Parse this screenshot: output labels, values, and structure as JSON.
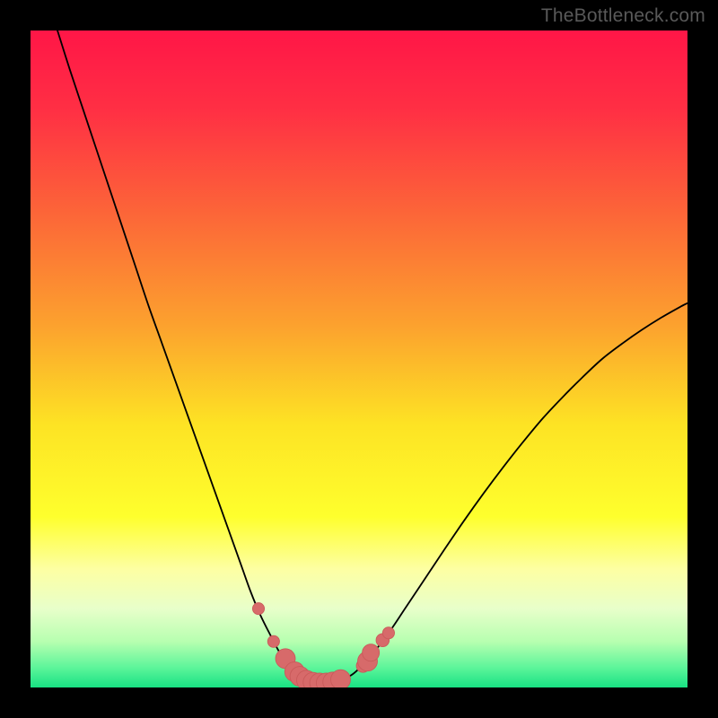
{
  "watermark": "TheBottleneck.com",
  "colors": {
    "marker_fill": "#d76a6a",
    "marker_stroke": "#c95a5a",
    "curve_stroke": "#000000"
  },
  "gradient_stops": [
    {
      "offset": 0.0,
      "color": "#ff1647"
    },
    {
      "offset": 0.12,
      "color": "#ff2f44"
    },
    {
      "offset": 0.28,
      "color": "#fc6638"
    },
    {
      "offset": 0.45,
      "color": "#fca22e"
    },
    {
      "offset": 0.6,
      "color": "#fde324"
    },
    {
      "offset": 0.74,
      "color": "#feff2d"
    },
    {
      "offset": 0.82,
      "color": "#fdffa3"
    },
    {
      "offset": 0.88,
      "color": "#e8ffca"
    },
    {
      "offset": 0.93,
      "color": "#b7ffb0"
    },
    {
      "offset": 0.97,
      "color": "#5cf59a"
    },
    {
      "offset": 1.0,
      "color": "#18e183"
    }
  ],
  "chart_data": {
    "type": "line",
    "title": "",
    "xlabel": "",
    "ylabel": "",
    "xlim": [
      0,
      100
    ],
    "ylim": [
      0,
      100
    ],
    "series": [
      {
        "name": "bottleneck-curve",
        "x": [
          4.1,
          6,
          8,
          10,
          12,
          14,
          16,
          18,
          20,
          22,
          24,
          26,
          28,
          30,
          32,
          33.5,
          35,
          36.5,
          38,
          39.5,
          41,
          42.5,
          44,
          45.5,
          47,
          49,
          51,
          53,
          55,
          57,
          60,
          63,
          66,
          69,
          72,
          75,
          78,
          81,
          84,
          87,
          90,
          93,
          96,
          99,
          100
        ],
        "y": [
          100,
          94,
          88,
          82,
          76,
          70,
          64,
          58,
          52.4,
          46.8,
          41.2,
          35.6,
          30,
          24.4,
          18.8,
          14.6,
          11,
          8,
          5.2,
          3.3,
          1.9,
          1,
          0.7,
          0.7,
          1,
          2,
          3.9,
          6.3,
          9,
          12,
          16.5,
          21,
          25.4,
          29.6,
          33.6,
          37.4,
          41,
          44.2,
          47.2,
          50,
          52.3,
          54.4,
          56.3,
          58,
          58.5
        ]
      }
    ],
    "markers": [
      {
        "x": 34.7,
        "y": 12,
        "r": 0.9
      },
      {
        "x": 37.0,
        "y": 7.0,
        "r": 0.9
      },
      {
        "x": 38.8,
        "y": 4.4,
        "r": 1.5
      },
      {
        "x": 40.2,
        "y": 2.4,
        "r": 1.5
      },
      {
        "x": 41.0,
        "y": 1.7,
        "r": 1.5
      },
      {
        "x": 42.0,
        "y": 1.1,
        "r": 1.5
      },
      {
        "x": 43.0,
        "y": 0.8,
        "r": 1.5
      },
      {
        "x": 44.0,
        "y": 0.7,
        "r": 1.5
      },
      {
        "x": 45.0,
        "y": 0.7,
        "r": 1.5
      },
      {
        "x": 46.0,
        "y": 0.85,
        "r": 1.5
      },
      {
        "x": 47.2,
        "y": 1.2,
        "r": 1.5
      },
      {
        "x": 50.6,
        "y": 3.3,
        "r": 1.0
      },
      {
        "x": 51.3,
        "y": 4.0,
        "r": 1.5
      },
      {
        "x": 51.8,
        "y": 5.3,
        "r": 1.3
      },
      {
        "x": 53.6,
        "y": 7.2,
        "r": 1.0
      },
      {
        "x": 54.5,
        "y": 8.3,
        "r": 0.9
      }
    ]
  }
}
